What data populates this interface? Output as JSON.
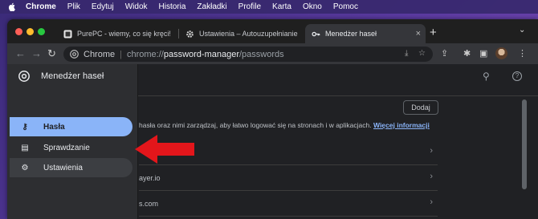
{
  "menubar": {
    "app": "Chrome",
    "items": [
      "Plik",
      "Edytuj",
      "Widok",
      "Historia",
      "Zakładki",
      "Profile",
      "Karta",
      "Okno",
      "Pomoc"
    ]
  },
  "tabs": [
    {
      "title": "PurePC - wiemy, co się kręci!",
      "active": false
    },
    {
      "title": "Ustawienia – Autouzupełnianie",
      "active": false
    },
    {
      "title": "Menedżer haseł",
      "active": true
    }
  ],
  "omnibox": {
    "site": "Chrome",
    "url_scheme": "chrome://",
    "url_host": "password-manager",
    "url_path": "/passwords"
  },
  "page": {
    "add_label": "Dodaj",
    "description_fragment": "hasła oraz nimi zarządzaj, aby łatwo logować się na stronach i w aplikacjach.",
    "learn_more": "Więcej informacji",
    "rows": [
      "",
      "ayer.io",
      "s.com"
    ]
  },
  "drawer": {
    "title": "Menedżer haseł",
    "items": [
      {
        "label": "Hasła",
        "icon": "key-icon",
        "active": true
      },
      {
        "label": "Sprawdzanie",
        "icon": "clipboard-check-icon",
        "active": false
      },
      {
        "label": "Ustawienia",
        "icon": "gear-icon",
        "active": false
      }
    ]
  },
  "colors": {
    "accent": "#8ab4f8",
    "annotation_arrow": "#e3161b",
    "window_bg": "#202124"
  }
}
